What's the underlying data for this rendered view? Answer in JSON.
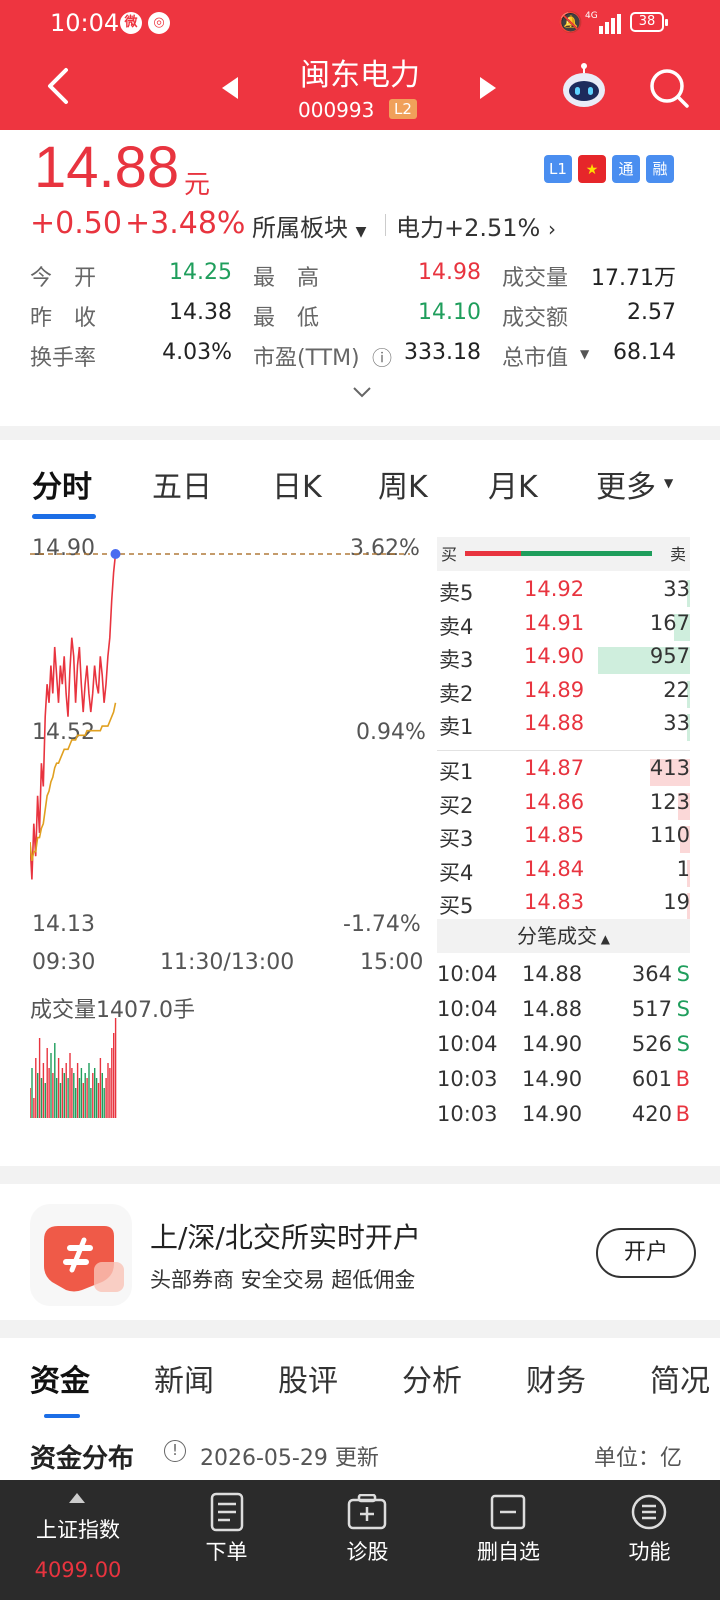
{
  "status_bar": {
    "time": "10:04",
    "battery": "38",
    "network": "4G"
  },
  "header": {
    "stock_name": "闽东电力",
    "stock_code": "000993",
    "level_badge": "L2"
  },
  "quote": {
    "price": "14.88",
    "unit": "元",
    "change": "+0.50",
    "change_pct": "+3.48%",
    "sector_label": "所属板块",
    "sector_value": "电力+2.51%",
    "tags": [
      "L1",
      "",
      "通",
      "融"
    ],
    "rows": [
      [
        {
          "l": "今　开",
          "v": "14.25",
          "c": "green"
        },
        {
          "l": "最　高",
          "v": "14.98",
          "c": "red"
        },
        {
          "l": "成交量",
          "v": "17.71万",
          "c": ""
        }
      ],
      [
        {
          "l": "昨　收",
          "v": "14.38",
          "c": ""
        },
        {
          "l": "最　低",
          "v": "14.10",
          "c": "green"
        },
        {
          "l": "成交额",
          "v": "2.57",
          "c": ""
        }
      ],
      [
        {
          "l": "换手率",
          "v": "4.03%",
          "c": ""
        },
        {
          "l": "市盈(TTM)",
          "v": "333.18",
          "c": ""
        },
        {
          "l": "总市值",
          "v": "68.14",
          "c": ""
        }
      ]
    ]
  },
  "chart_tabs": [
    "分时",
    "五日",
    "日K",
    "周K",
    "月K",
    "更多"
  ],
  "chart_data": {
    "type": "line",
    "y_high": "14.90",
    "y_mid": "14.52",
    "y_low": "14.13",
    "pct_high": "3.62%",
    "pct_mid": "0.94%",
    "pct_low": "-1.74%",
    "x_labels": [
      "09:30",
      "11:30/13:00",
      "15:00"
    ],
    "volume_label": "成交量1407.0手",
    "ylim": [
      14.13,
      14.9
    ],
    "series": [
      {
        "values": [
          14.28,
          14.2,
          14.32,
          14.25,
          14.38,
          14.3,
          14.45,
          14.4,
          14.55,
          14.62,
          14.58,
          14.66,
          14.6,
          14.7,
          14.64,
          14.58,
          14.66,
          14.62,
          14.68,
          14.6,
          14.55,
          14.65,
          14.72,
          14.68,
          14.58,
          14.66,
          14.7,
          14.62,
          14.56,
          14.62,
          14.66,
          14.6,
          14.56,
          14.6,
          14.66,
          14.62,
          14.6,
          14.68,
          14.64,
          14.58,
          14.62,
          14.68,
          14.72,
          14.8,
          14.86,
          14.9
        ]
      },
      {
        "values": [
          14.28,
          14.24,
          14.26,
          14.26,
          14.29,
          14.29,
          14.31,
          14.32,
          14.35,
          14.38,
          14.39,
          14.41,
          14.42,
          14.44,
          14.45,
          14.45,
          14.46,
          14.47,
          14.48,
          14.48,
          14.48,
          14.49,
          14.5,
          14.5,
          14.5,
          14.51,
          14.51,
          14.51,
          14.51,
          14.51,
          14.52,
          14.52,
          14.52,
          14.52,
          14.52,
          14.52,
          14.52,
          14.52,
          14.53,
          14.53,
          14.53,
          14.53,
          14.54,
          14.55,
          14.56,
          14.58
        ]
      }
    ],
    "volumes": [
      30,
      50,
      20,
      60,
      45,
      80,
      40,
      55,
      35,
      70,
      50,
      65,
      45,
      75,
      40,
      60,
      35,
      50,
      45,
      55,
      40,
      65,
      50,
      45,
      30,
      55,
      40,
      50,
      35,
      45,
      40,
      55,
      30,
      45,
      50,
      40,
      35,
      60,
      45,
      30,
      40,
      55,
      50,
      70,
      85,
      100
    ],
    "volume_colors": [
      "r",
      "g",
      "r",
      "r",
      "g",
      "r",
      "g",
      "r",
      "g",
      "r",
      "r",
      "g",
      "r",
      "g",
      "g",
      "r",
      "g",
      "r",
      "g",
      "r",
      "g",
      "r",
      "r",
      "g",
      "g",
      "r",
      "g",
      "g",
      "r",
      "g",
      "r",
      "g",
      "g",
      "r",
      "g",
      "g",
      "r",
      "r",
      "g",
      "g",
      "r",
      "r",
      "r",
      "r",
      "r",
      "r"
    ]
  },
  "orderbook": {
    "sell": [
      {
        "l": "卖5",
        "p": "14.92",
        "v": "33",
        "w": 0.03
      },
      {
        "l": "卖4",
        "p": "14.91",
        "v": "167",
        "w": 0.17
      },
      {
        "l": "卖3",
        "p": "14.90",
        "v": "957",
        "w": 1.0
      },
      {
        "l": "卖2",
        "p": "14.89",
        "v": "22",
        "w": 0.02
      },
      {
        "l": "卖1",
        "p": "14.88",
        "v": "33",
        "w": 0.03
      }
    ],
    "buy": [
      {
        "l": "买1",
        "p": "14.87",
        "v": "413",
        "w": 0.43
      },
      {
        "l": "买2",
        "p": "14.86",
        "v": "123",
        "w": 0.13
      },
      {
        "l": "买3",
        "p": "14.85",
        "v": "110",
        "w": 0.11
      },
      {
        "l": "买4",
        "p": "14.84",
        "v": "1",
        "w": 0.005
      },
      {
        "l": "买5",
        "p": "14.83",
        "v": "19",
        "w": 0.02
      }
    ],
    "buy_label": "买",
    "sell_label": "卖",
    "buy_ratio": 0.3,
    "trades_title": "分笔成交",
    "trades": [
      {
        "t": "10:04",
        "p": "14.88",
        "v": "364",
        "s": "S"
      },
      {
        "t": "10:04",
        "p": "14.88",
        "v": "517",
        "s": "S"
      },
      {
        "t": "10:04",
        "p": "14.90",
        "v": "526",
        "s": "S"
      },
      {
        "t": "10:03",
        "p": "14.90",
        "v": "601",
        "s": "B"
      },
      {
        "t": "10:03",
        "p": "14.90",
        "v": "420",
        "s": "B"
      }
    ]
  },
  "account_ad": {
    "title": "上/深/北交所实时开户",
    "subtitle": "头部券商  安全交易  超低佣金",
    "button": "开户"
  },
  "bottom_tabs": [
    "资金",
    "新闻",
    "股评",
    "分析",
    "财务",
    "简况"
  ],
  "fund": {
    "title": "资金分布",
    "date": "2026-05-29 更新",
    "unit": "单位：亿"
  },
  "nav": {
    "index_name": "上证指数",
    "index_value": "4099.00",
    "items": [
      "下单",
      "诊股",
      "删自选",
      "功能"
    ]
  },
  "colors": {
    "brand_red": "#ee3540",
    "up": "#e8343f",
    "down": "#1f9e5c",
    "accent": "#1c6ee6"
  }
}
